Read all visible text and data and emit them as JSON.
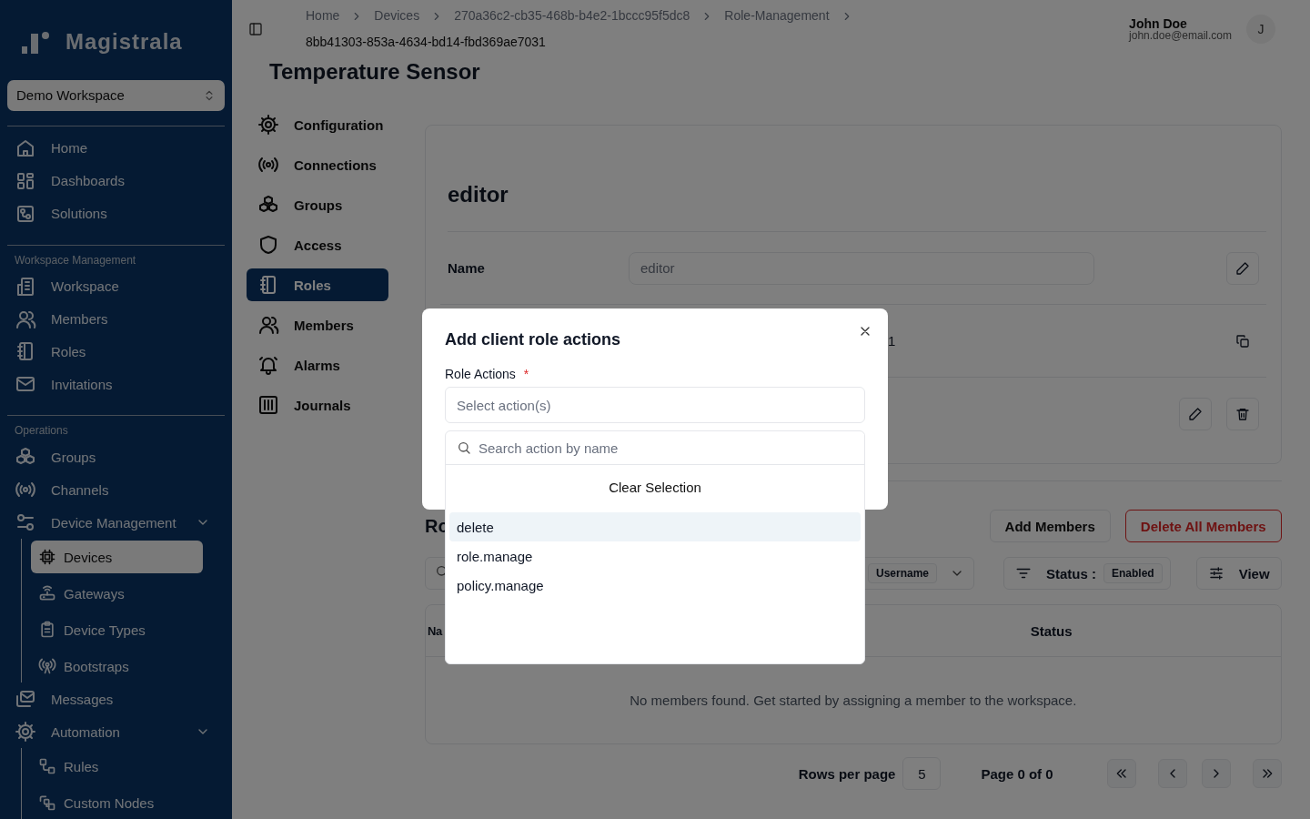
{
  "sidebar": {
    "brand": "Magistrala",
    "workspace": "Demo Workspace",
    "groups": [
      {
        "items": [
          {
            "label": "Home",
            "selected": false
          },
          {
            "label": "Dashboards",
            "selected": false
          },
          {
            "label": "Solutions",
            "selected": false
          }
        ]
      },
      {
        "title": "Workspace Management",
        "items": [
          {
            "label": "Workspace",
            "selected": false
          },
          {
            "label": "Members",
            "selected": false
          },
          {
            "label": "Roles",
            "selected": false
          },
          {
            "label": "Invitations",
            "selected": false
          }
        ]
      },
      {
        "title": "Operations",
        "items": [
          {
            "label": "Groups",
            "selected": false
          },
          {
            "label": "Channels",
            "selected": false
          },
          {
            "label": "Device Management",
            "selected": false,
            "expanded": true,
            "children": [
              {
                "label": "Devices",
                "selected": true
              },
              {
                "label": "Gateways",
                "selected": false
              },
              {
                "label": "Device Types",
                "selected": false
              },
              {
                "label": "Bootstraps",
                "selected": false
              }
            ]
          },
          {
            "label": "Messages",
            "selected": false
          },
          {
            "label": "Automation",
            "selected": false,
            "expanded": true,
            "children": [
              {
                "label": "Rules",
                "selected": false
              },
              {
                "label": "Custom Nodes",
                "selected": false
              }
            ]
          }
        ]
      }
    ]
  },
  "header": {
    "breadcrumbs": [
      "Home",
      "Devices",
      "270a36c2-cb35-468b-b4e2-1bccc95f5dc8",
      "Role-Management",
      "8bb41303-853a-4634-bd14-fbd369ae7031"
    ],
    "user": {
      "name": "John Doe",
      "email": "john.doe@email.com",
      "initial": "J"
    }
  },
  "page_title": "Temperature Sensor",
  "entity_nav": [
    {
      "label": "Configuration",
      "selected": false
    },
    {
      "label": "Connections",
      "selected": false
    },
    {
      "label": "Groups",
      "selected": false
    },
    {
      "label": "Access",
      "selected": false
    },
    {
      "label": "Roles",
      "selected": true
    },
    {
      "label": "Members",
      "selected": false
    },
    {
      "label": "Alarms",
      "selected": false
    },
    {
      "label": "Journals",
      "selected": false
    }
  ],
  "role_card": {
    "title": "editor",
    "rows": [
      {
        "kind": "input",
        "label": "Name",
        "value": "editor"
      },
      {
        "kind": "id",
        "value": "1"
      },
      {
        "kind": "actions"
      }
    ]
  },
  "members": {
    "title": "Ro",
    "buttons": [
      {
        "label": "Add Members",
        "kind": "outline"
      },
      {
        "label": "Delete All Members",
        "kind": "danger"
      }
    ],
    "search": {
      "filter_by": "Username"
    },
    "status_filter": {
      "label": "Status :",
      "value": "Enabled"
    },
    "view": "View",
    "columns": [
      "Na",
      "Status"
    ],
    "empty": "No members found. Get started by assigning a member to the workspace.",
    "pagination": {
      "rows_label": "Rows per page",
      "rows": "5",
      "page": "Page 0 of 0"
    }
  },
  "dialog": {
    "title": "Add client role actions",
    "field_label": "Role Actions",
    "required_mark": "*",
    "placeholder": "Select action(s)",
    "search_placeholder": "Search action by name",
    "clear": "Clear Selection",
    "options": [
      {
        "label": "delete",
        "highlighted": true
      },
      {
        "label": "role.manage",
        "highlighted": false
      },
      {
        "label": "policy.manage",
        "highlighted": false
      }
    ]
  }
}
